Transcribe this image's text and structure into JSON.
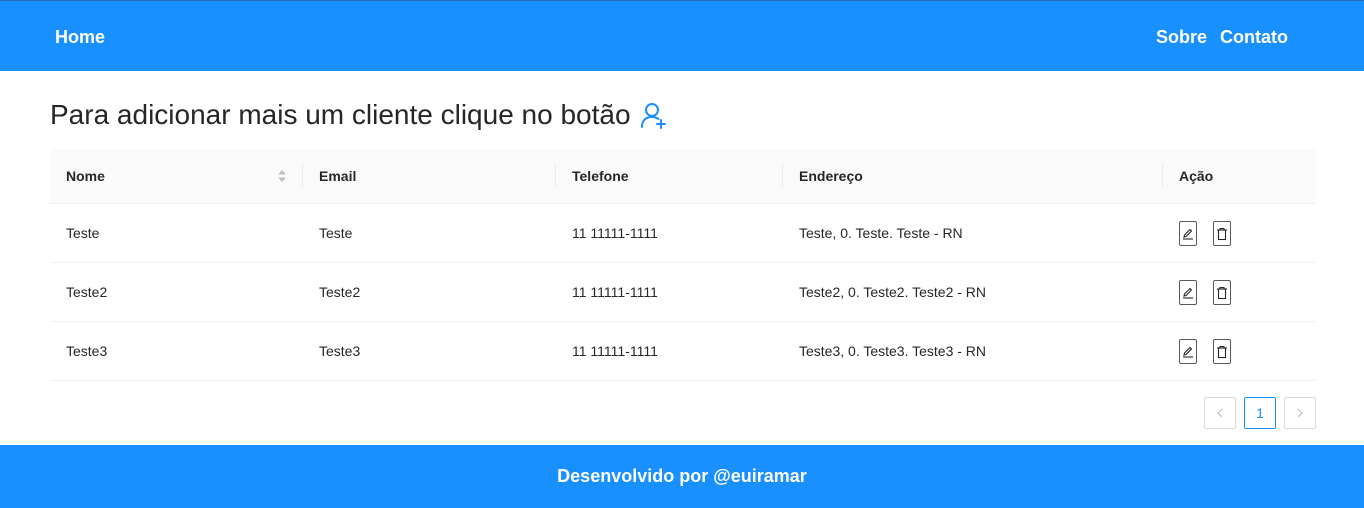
{
  "nav": {
    "home": "Home",
    "sobre": "Sobre",
    "contato": "Contato"
  },
  "heading": {
    "text": "Para adicionar mais um cliente clique no botão",
    "icon": "user-add-icon"
  },
  "table": {
    "columns": [
      "Nome",
      "Email",
      "Telefone",
      "Endereço",
      "Ação"
    ],
    "rows": [
      {
        "nome": "Teste",
        "email": "Teste",
        "telefone": "11 11111-1111",
        "endereco": "Teste, 0. Teste. Teste - RN"
      },
      {
        "nome": "Teste2",
        "email": "Teste2",
        "telefone": "11 11111-1111",
        "endereco": "Teste2, 0. Teste2. Teste2 - RN"
      },
      {
        "nome": "Teste3",
        "email": "Teste3",
        "telefone": "11 11111-1111",
        "endereco": "Teste3, 0. Teste3. Teste3 - RN"
      }
    ],
    "action_icons": [
      "edit-icon",
      "delete-icon"
    ]
  },
  "pagination": {
    "current_page": "1"
  },
  "footer": {
    "text": "Desenvolvido por @euiramar"
  },
  "colors": {
    "primary": "#1890ff",
    "header_bg": "#fafafa",
    "border": "#f0f0f0"
  }
}
